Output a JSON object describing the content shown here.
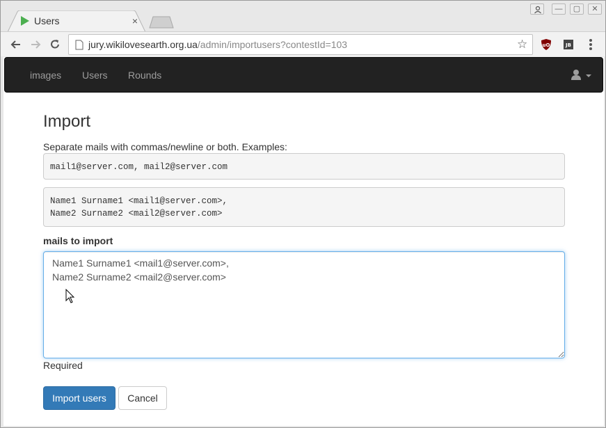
{
  "browser": {
    "tab": {
      "title": "Users",
      "close": "×"
    },
    "address": {
      "host": "jury.wikilovesearth.org.ua",
      "path": "/admin/importusers?contestId=103"
    },
    "star": "☆",
    "window_buttons": {
      "minimize": "—",
      "maximize": "▢",
      "close": "✕"
    },
    "extensions": [
      "ublock-origin-icon",
      "jetbrains-icon"
    ]
  },
  "navbar": {
    "links": [
      {
        "label": "images"
      },
      {
        "label": "Users"
      },
      {
        "label": "Rounds"
      }
    ]
  },
  "page": {
    "title": "Import",
    "help": "Separate mails with commas/newline or both. Examples:",
    "example1": "mail1@server.com, mail2@server.com",
    "example2": "Name1 Surname1 <mail1@server.com>,\nName2 Surname2 <mail2@server.com>",
    "field_label": "mails to import",
    "textarea_value": "Name1 Surname1 <mail1@server.com>,\nName2 Surname2 <mail2@server.com>",
    "required": "Required",
    "buttons": {
      "import": "Import users",
      "cancel": "Cancel"
    }
  },
  "colors": {
    "navbar_bg": "#222222",
    "primary": "#337ab7",
    "focus": "#66afe9",
    "favicon": "#4caf50",
    "ublock": "#800000"
  }
}
